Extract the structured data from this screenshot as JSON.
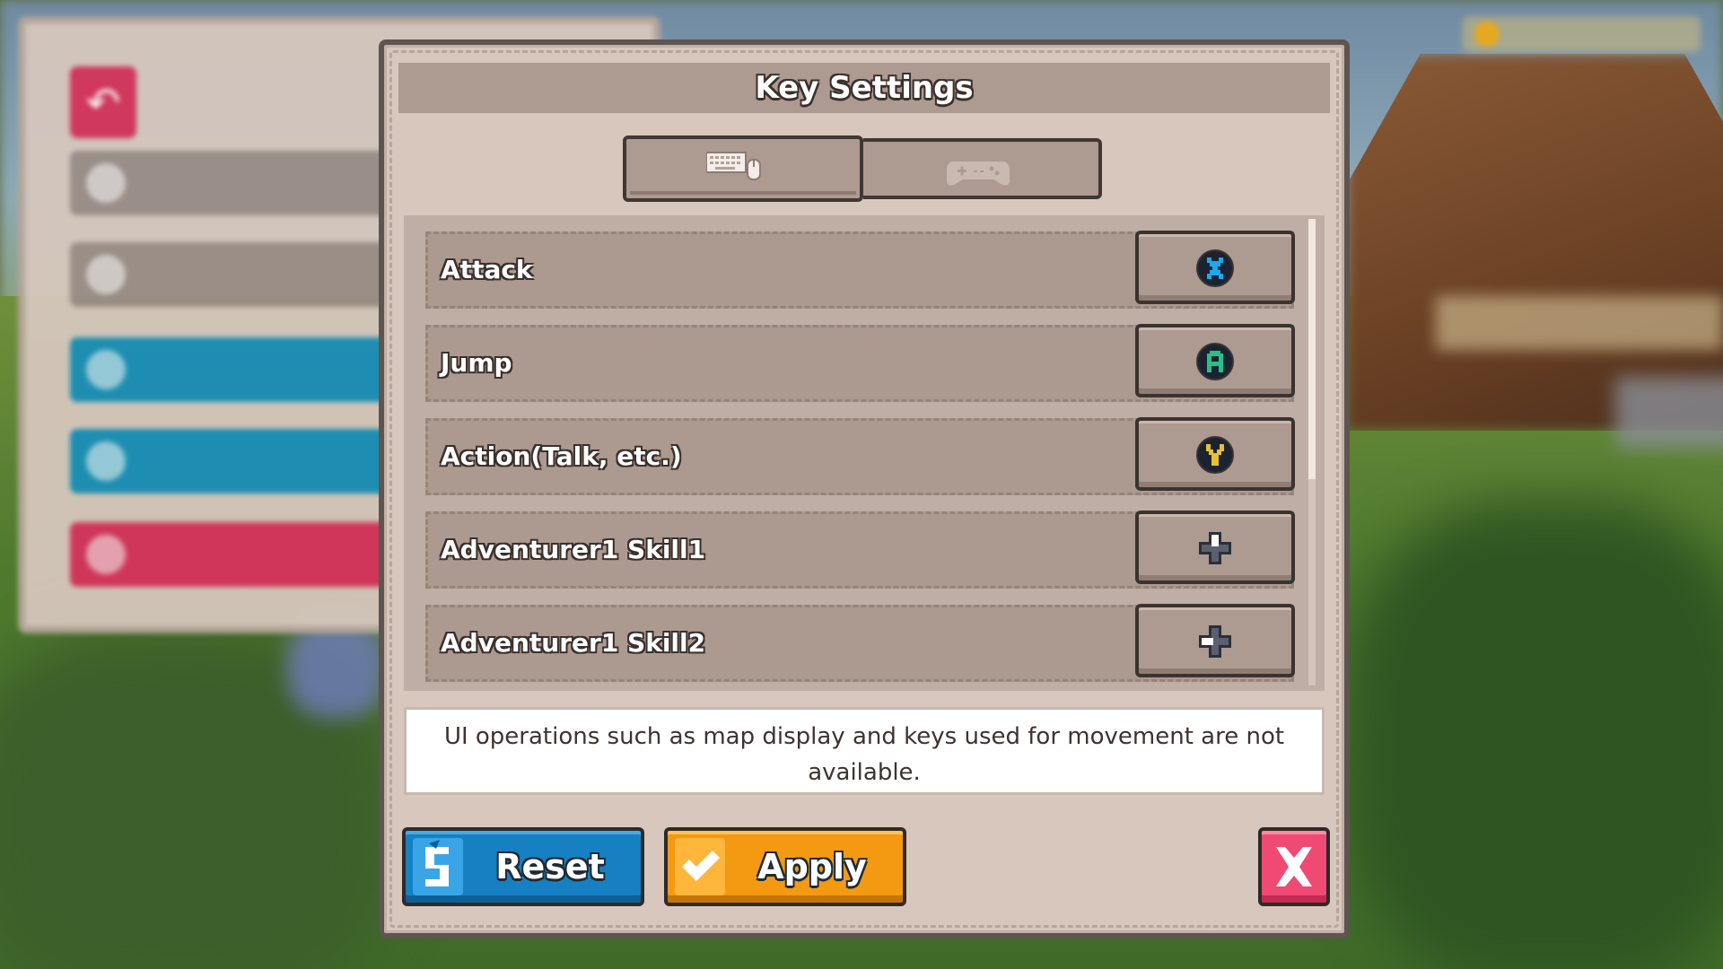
{
  "dialog": {
    "title": "Key Settings",
    "tabs": [
      {
        "name": "keyboard-mouse",
        "icon": "keyboard-mouse-icon",
        "active": true
      },
      {
        "name": "gamepad",
        "icon": "gamepad-icon",
        "active": false
      }
    ],
    "bindings": [
      {
        "label": "Attack",
        "key_icon": "x-button-icon",
        "key_glyph": "X",
        "color": "#1aa8f0"
      },
      {
        "label": "Jump",
        "key_icon": "a-button-icon",
        "key_glyph": "A",
        "color": "#25c18a"
      },
      {
        "label": "Action(Talk, etc.)",
        "key_icon": "y-button-icon",
        "key_glyph": "Y",
        "color": "#e8c22e"
      },
      {
        "label": "Adventurer1 Skill1",
        "key_icon": "dpad-up-icon",
        "key_glyph": "",
        "color": "#ffffff"
      },
      {
        "label": "Adventurer1 Skill2",
        "key_icon": "dpad-left-icon",
        "key_glyph": "",
        "color": "#ffffff"
      }
    ],
    "info": "UI operations such as map display and keys used for movement are not available.",
    "buttons": {
      "reset": "Reset",
      "apply": "Apply",
      "close_icon": "close-icon"
    }
  },
  "colors": {
    "reset": "#1780c3",
    "apply": "#f39a12",
    "close": "#ee4a73",
    "panel": "#d7c7bd"
  }
}
